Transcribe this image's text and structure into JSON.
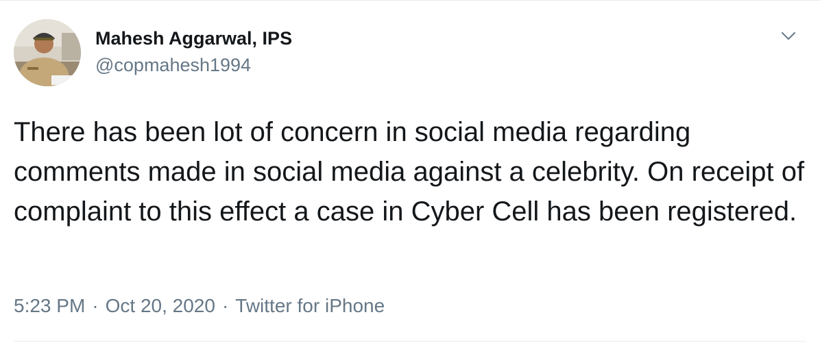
{
  "tweet": {
    "author": {
      "display_name": "Mahesh Aggarwal, IPS",
      "handle": "@copmahesh1994",
      "avatar_icon": "profile-photo-icon"
    },
    "more_icon": "chevron-down-icon",
    "text": "There has been lot of concern in social media regarding comments made in social media against a celebrity. On receipt of complaint to this effect a case in Cyber Cell has been registered.",
    "time": "5:23 PM",
    "date": "Oct 20, 2020",
    "source": "Twitter for iPhone",
    "separator": "·"
  },
  "colors": {
    "text_primary": "#14171a",
    "text_secondary": "#657786",
    "divider": "#e6ecf0"
  }
}
